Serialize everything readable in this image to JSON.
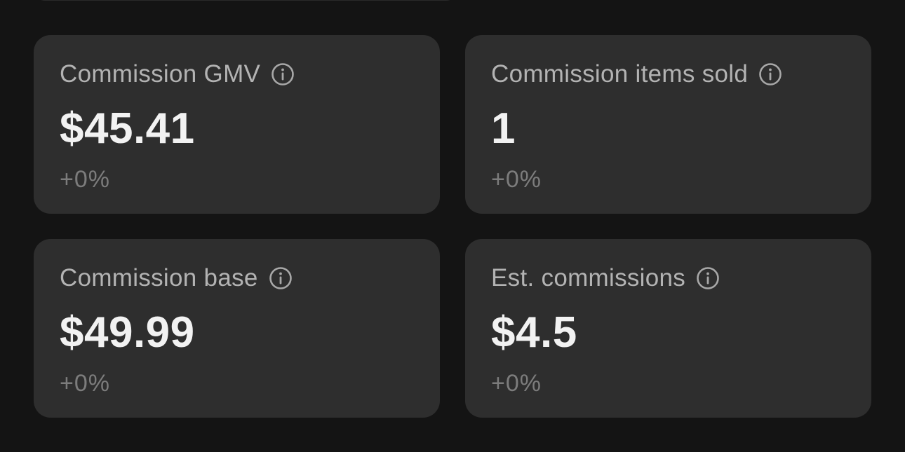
{
  "metrics": [
    {
      "title": "Commission GMV",
      "value": "$45.41",
      "change": "+0%",
      "icon": "info-icon"
    },
    {
      "title": "Commission items sold",
      "value": "1",
      "change": "+0%",
      "icon": "info-icon"
    },
    {
      "title": "Commission base",
      "value": "$49.99",
      "change": "+0%",
      "icon": "info-icon"
    },
    {
      "title": "Est. commissions",
      "value": "$4.5",
      "change": "+0%",
      "icon": "info-icon"
    }
  ],
  "colors": {
    "background": "#141414",
    "card": "#2e2e2e",
    "title": "#b3b3b3",
    "value": "#f2f2f2",
    "change": "#7c7c7c"
  }
}
